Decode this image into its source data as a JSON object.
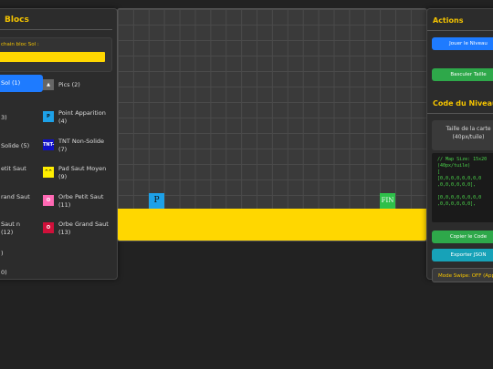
{
  "left_panel": {
    "title": "Blocs",
    "next_label": "chain bloc Sol :",
    "next_color": "#ffd700",
    "blocks": [
      {
        "label": "Sol (1)"
      },
      {
        "label": "Pics (2)",
        "swatch": "#666666",
        "glyph": "▲"
      },
      {
        "label": "3)"
      },
      {
        "label": "Point Apparition (4)",
        "swatch": "#1da1e8",
        "glyph": "P"
      },
      {
        "label": "Solide (5)"
      },
      {
        "label": "TNT Non-Solide (7)",
        "swatch": "#1010c8",
        "glyph": "TNT-"
      },
      {
        "label": "etit Saut"
      },
      {
        "label": "Pad Saut Moyen (9)",
        "swatch": "#ffee00",
        "glyph": "^^"
      },
      {
        "label": "rand Saut"
      },
      {
        "label": "Orbe Petit Saut (11)",
        "swatch": "#ff69b4",
        "glyph": "O"
      },
      {
        "label": "Saut n (12)"
      },
      {
        "label": "Orbe Grand Saut (13)",
        "swatch": "#d0103a",
        "glyph": "O"
      },
      {
        "label": ")"
      },
      {
        "label": "0)"
      }
    ]
  },
  "canvas": {
    "start_marker": "P",
    "end_marker": "FIN",
    "ground_color": "#ffd700"
  },
  "right_panel": {
    "actions_title": "Actions",
    "play_button": "Jouer le Niveau",
    "toggle_button": "Basculer Taille",
    "code_title": "Code du Niveau",
    "size_text_1": "Taille de la carte",
    "size_text_2": "(40px/tuile)",
    "code_text": "// Map Size: 15x20\n(40px/tuile)\n[\n[0,0,0,0,0,0,0,0\n,0,0,0,0,0,0],\n\n[0,0,0,0,0,0,0,0\n,0,0,0,0,0,0],",
    "copy_button": "Copier le Code",
    "export_button": "Exporter JSON",
    "swipe_mode": "Mode Swipe: OFF (Appuyer)"
  }
}
